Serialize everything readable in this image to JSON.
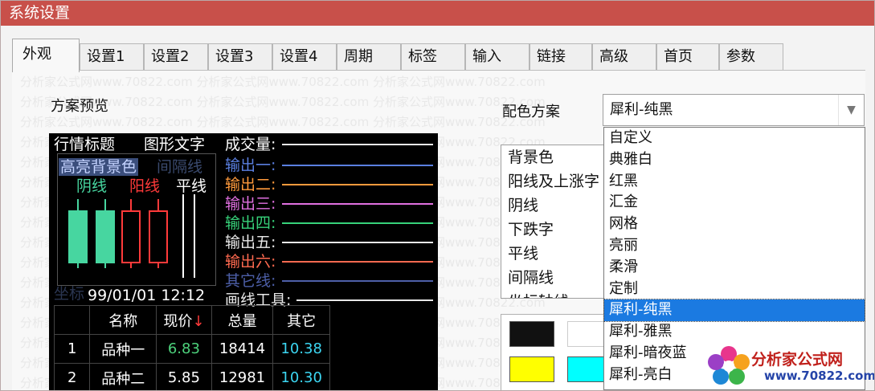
{
  "window": {
    "title": "系统设置"
  },
  "tabs": [
    "外观",
    "设置1",
    "设置2",
    "设置3",
    "设置4",
    "周期",
    "标签",
    "输入",
    "链接",
    "高级",
    "首页",
    "参数"
  ],
  "watermark": "分析家公式网www.70822.com   分析家公式网www.70822.com   分析家公式网www.70822.com",
  "appearance": {
    "preview_label": "方案预览",
    "scheme_label": "配色方案",
    "scheme_selected": "犀利-纯黑",
    "scheme_options": [
      "自定义",
      "典雅白",
      "红黑",
      "汇金",
      "网格",
      "亮丽",
      "柔滑",
      "定制",
      "犀利-纯黑",
      "犀利-雅黑",
      "犀利-暗夜蓝",
      "犀利-亮白"
    ],
    "color_items": [
      "背景色",
      "阳线及上涨字",
      "阴线",
      "下跌字",
      "平线",
      "间隔线",
      "坐标轴线"
    ]
  },
  "preview": {
    "quote_title": "行情标题",
    "graphic_text": "图形文字",
    "volume": "成交量:",
    "highlight_bg": "高亮背景色",
    "interval_line": "间隔线",
    "yin": "阴线",
    "yang": "阳线",
    "flat": "平线",
    "outputs": [
      "输出一:",
      "输出二:",
      "输出三:",
      "输出四:",
      "输出五:",
      "输出六:",
      "其它线:",
      "画线工具:"
    ],
    "output_colors": [
      "#5a7fe0",
      "#ff9a3c",
      "#e070e0",
      "#37d27a",
      "#e8e8e8",
      "#ff6a50",
      "#4d5fa8",
      "#e8e8e8"
    ],
    "axis_label": "坐标",
    "datetime": "99/01/01 12:12",
    "colors": {
      "yin": "#47d6a0",
      "yang": "#ff3a3a",
      "flat": "#ffffff"
    },
    "table": {
      "headers": [
        "",
        "名称",
        "现价",
        "总量",
        "其它"
      ],
      "sort_arrow": "↓",
      "rows": [
        [
          "1",
          "品种一",
          "6.83",
          "18414",
          "10.38"
        ],
        [
          "2",
          "品种二",
          "5.85",
          "12981",
          "10.30"
        ]
      ],
      "price_colors": [
        "#4dd27c",
        "#ffffff"
      ],
      "other_color": "#3cd6f2"
    }
  },
  "swatches": [
    "#111111",
    "#ffffff",
    "#ffff00",
    "#00ffff"
  ],
  "logo": {
    "name": "分析家公式网",
    "url": "www.70822.com"
  }
}
